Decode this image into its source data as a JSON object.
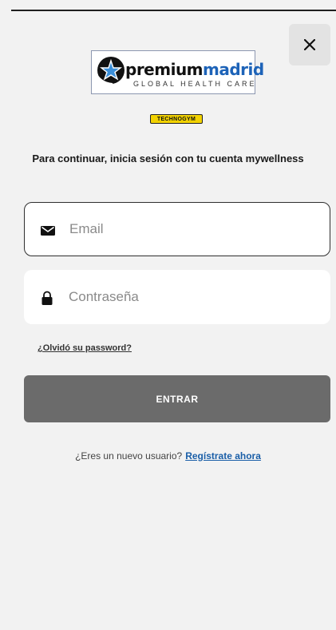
{
  "header": {
    "close_icon": "close-icon"
  },
  "logo": {
    "brand_part1": "premium",
    "brand_part2": "madrid",
    "tagline": "GLOBAL HEALTH CARE",
    "brand_color": "#1d63b8",
    "partner_badge": "TECHNOGYM",
    "partner_color": "#f2d200"
  },
  "login": {
    "instruction": "Para continuar, inicia sesión con tu cuenta mywellness",
    "email_placeholder": "Email",
    "email_value": "",
    "email_icon": "envelope-icon",
    "password_placeholder": "Contraseña",
    "password_value": "",
    "password_icon": "lock-icon",
    "forgot_label": "¿Olvidó su password?",
    "submit_label": "ENTRAR",
    "submit_color": "#6b6b6b"
  },
  "register": {
    "prompt": "¿Eres un nuevo usuario?",
    "link_label": "Regístrate ahora",
    "link_color": "#1b5fa8"
  }
}
